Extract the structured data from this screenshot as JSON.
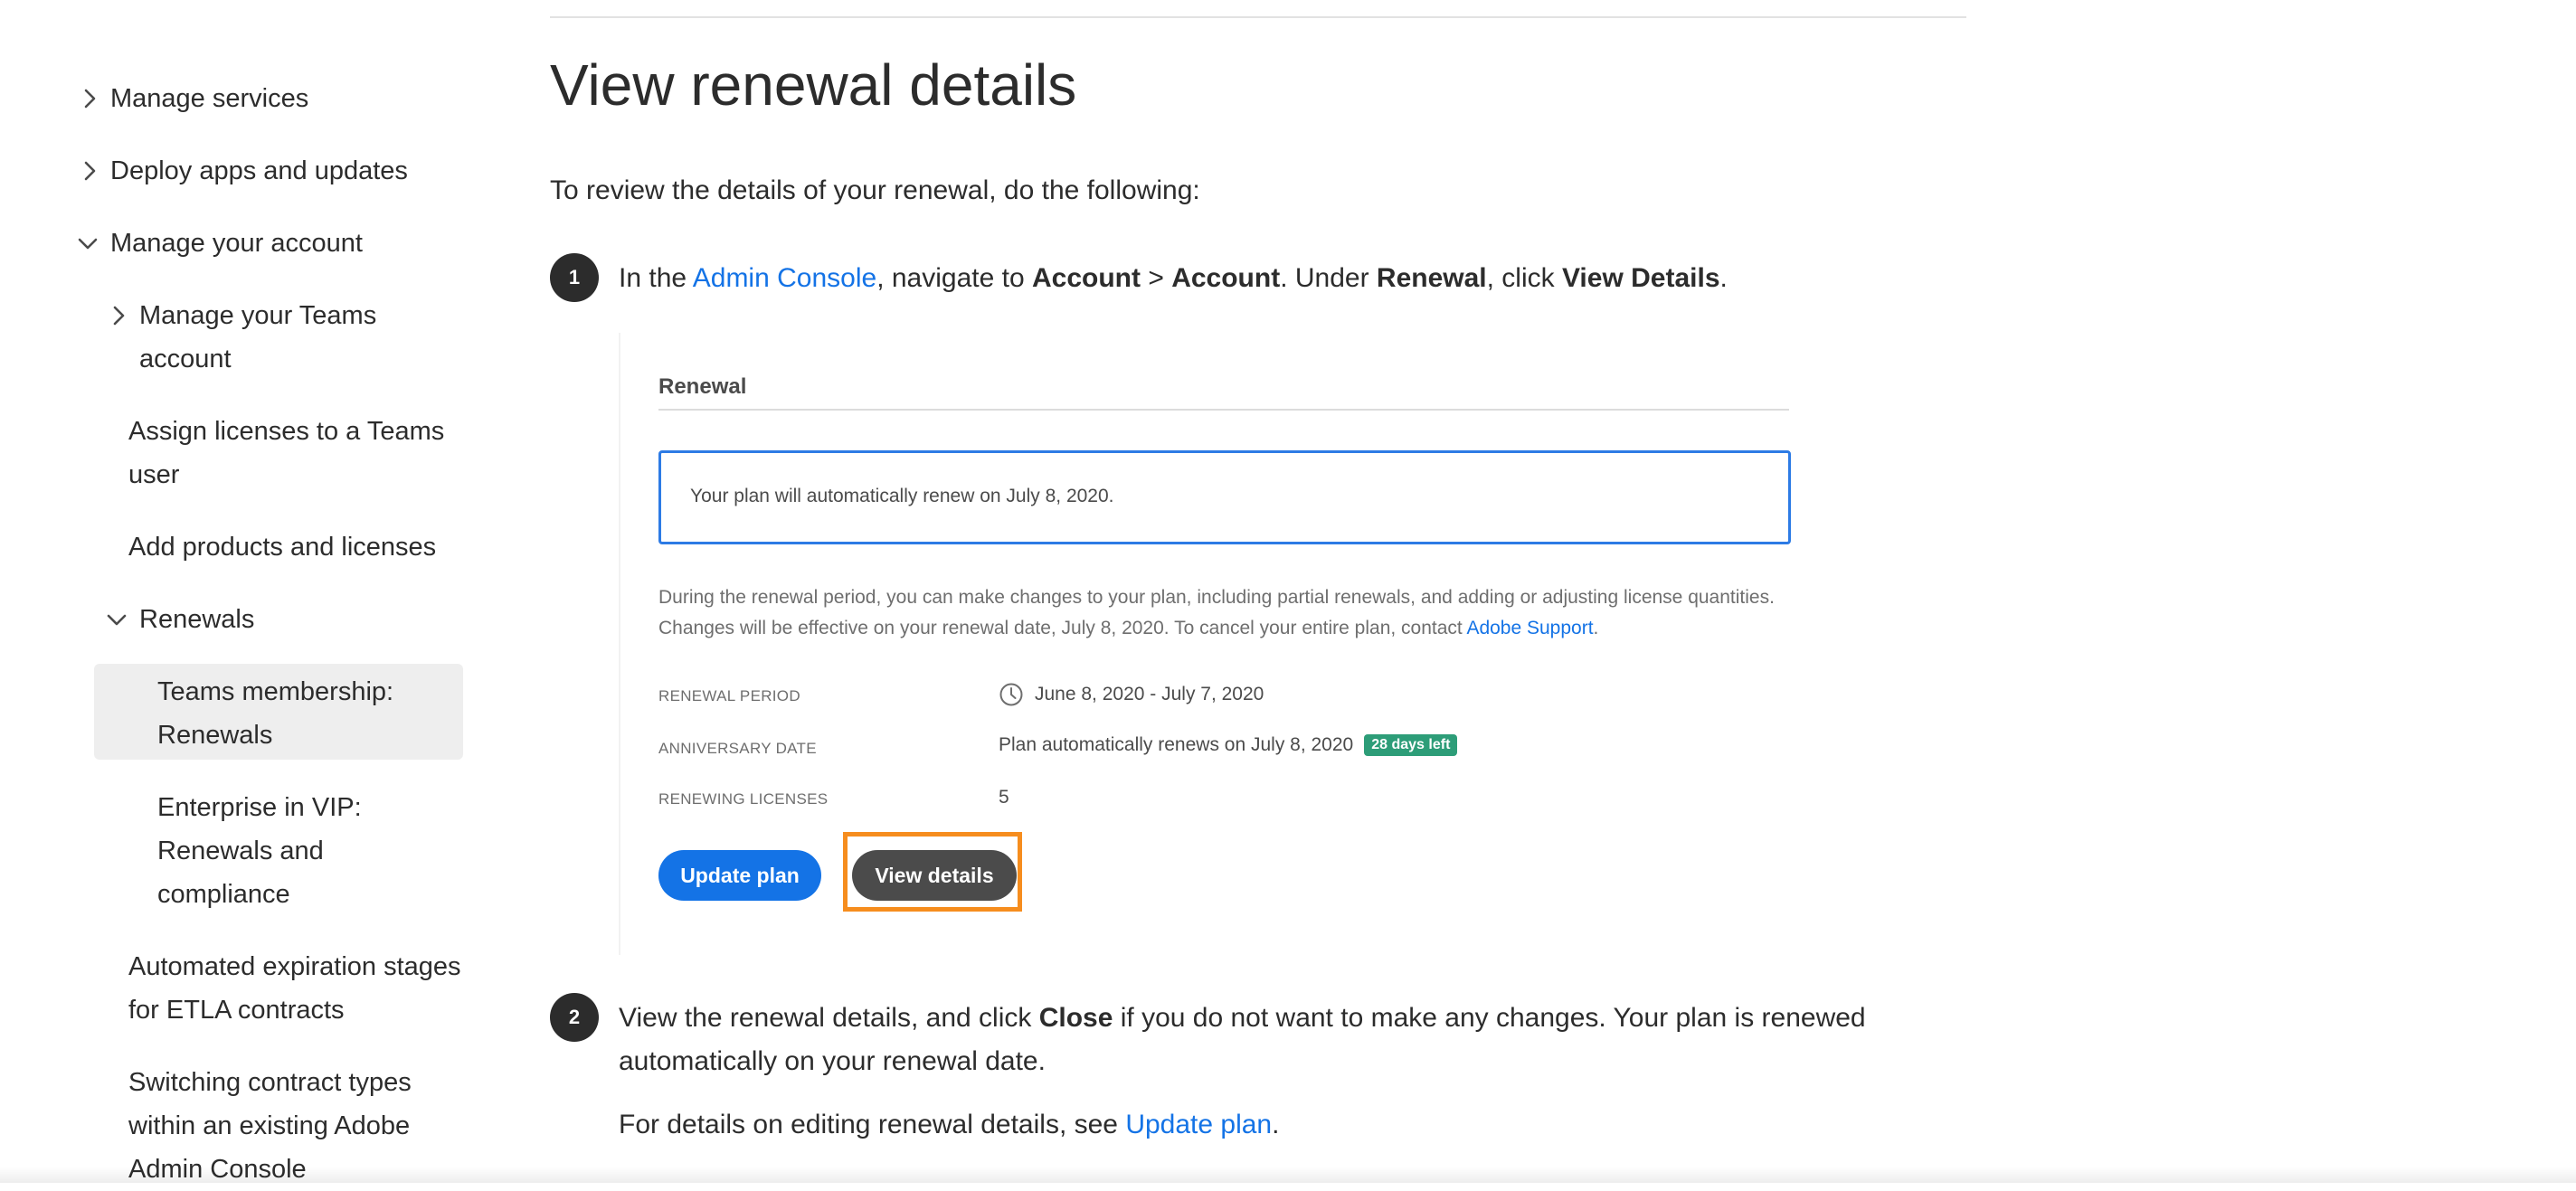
{
  "sidebar": {
    "items": [
      {
        "label": "Manage services",
        "chevron": "chevron-right-icon"
      },
      {
        "label": "Deploy apps and updates",
        "chevron": "chevron-right-icon"
      },
      {
        "label": "Manage your account",
        "chevron": "chevron-down-icon"
      },
      {
        "label_line1": "Manage your Teams",
        "label_line2": "account",
        "chevron": "chevron-right-icon"
      },
      {
        "label_line1": "Assign licenses to a Teams",
        "label_line2": "user"
      },
      {
        "label": "Add products and licenses"
      },
      {
        "label": "Renewals",
        "chevron": "chevron-down-icon"
      },
      {
        "label_line1": "Teams membership:",
        "label_line2": "Renewals",
        "selected": true
      },
      {
        "label_line1": "Enterprise in VIP:",
        "label_line2": "Renewals and",
        "label_line3": "compliance"
      },
      {
        "label_line1": "Automated expiration stages",
        "label_line2": "for ETLA contracts"
      },
      {
        "label_line1": "Switching contract types",
        "label_line2": "within an existing Adobe",
        "label_line3": "Admin Console"
      }
    ]
  },
  "main": {
    "title": "View renewal details",
    "intro": "To review the details of your renewal, do the following:",
    "step1": {
      "number": "1",
      "t1": "In the ",
      "link": "Admin Console",
      "t2": ", navigate to ",
      "b1": "Account",
      "t3": " > ",
      "b2": "Account",
      "t4": ". Under ",
      "b3": "Renewal",
      "t5": ", click ",
      "b4": "View Details",
      "t6": "."
    },
    "screenshot": {
      "heading": "Renewal",
      "notice": "Your plan will automatically renew on July 8, 2020.",
      "desc": "During the renewal period, you can make changes to your plan, including partial renewals, and adding or adjusting license quantities. Changes will be effective on your renewal date, July 8, 2020. To cancel your entire plan, contact ",
      "desc_link": "Adobe Support",
      "desc_end": ".",
      "rows": [
        {
          "label": "RENEWAL PERIOD",
          "value": "June 8, 2020 - July 7, 2020",
          "icon": "clock-icon"
        },
        {
          "label": "ANNIVERSARY DATE",
          "value": "Plan automatically renews on July 8, 2020",
          "badge": "28 days left"
        },
        {
          "label": "RENEWING LICENSES",
          "value": "5"
        }
      ],
      "update_button": "Update plan",
      "view_button": "View details",
      "colors": {
        "accent": "#1473e6",
        "highlight": "#f68d1e",
        "badge": "#2d9d78"
      }
    },
    "step2": {
      "number": "2",
      "t1": "View the renewal details, and click ",
      "b1": "Close",
      "t2": " if you do not want to make any changes. Your plan is renewed",
      "t3": "automatically on your renewal date."
    },
    "footer_note": {
      "t1": "For details on editing renewal details, see ",
      "link": "Update plan",
      "t2": "."
    }
  }
}
